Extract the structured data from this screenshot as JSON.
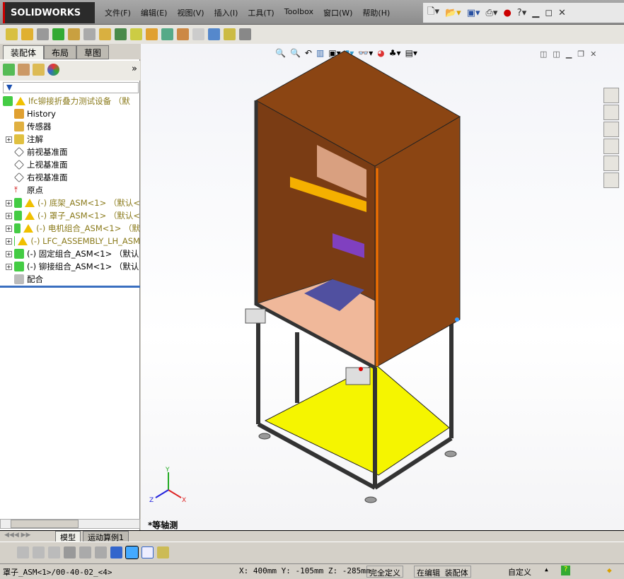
{
  "app": {
    "logo": "SOLIDWORKS"
  },
  "menu": [
    "文件(F)",
    "编辑(E)",
    "视图(V)",
    "插入(I)",
    "工具(T)",
    "Toolbox",
    "窗口(W)",
    "帮助(H)"
  ],
  "panel_tabs": [
    "装配体",
    "布局",
    "草图"
  ],
  "tree": {
    "root": "lfc铆接折叠力测试设备 （默",
    "items": [
      {
        "label": "History",
        "type": "history"
      },
      {
        "label": "传感器",
        "type": "sensor"
      },
      {
        "label": "注解",
        "type": "annotation",
        "expand": "+"
      },
      {
        "label": "前视基准面",
        "type": "plane"
      },
      {
        "label": "上视基准面",
        "type": "plane"
      },
      {
        "label": "右视基准面",
        "type": "plane"
      },
      {
        "label": "原点",
        "type": "origin"
      },
      {
        "label": "(-) 底架_ASM<1> （默认<",
        "type": "asm",
        "warn": true,
        "expand": "+"
      },
      {
        "label": "(-) 罩子_ASM<1> （默认<",
        "type": "asm",
        "warn": true,
        "expand": "+"
      },
      {
        "label": "(-) 电机组合_ASM<1> （默",
        "type": "asm",
        "warn": true,
        "expand": "+"
      },
      {
        "label": "(-) LFC_ASSEMBLY_LH_ASM",
        "type": "asm",
        "warn": true,
        "expand": "+"
      },
      {
        "label": "(-) 固定组合_ASM<1> （默认",
        "type": "asm",
        "warn": false,
        "expand": "+"
      },
      {
        "label": "(-) 铆接组合_ASM<1> （默认",
        "type": "asm",
        "warn": false,
        "expand": "+"
      },
      {
        "label": "配合",
        "type": "mate"
      }
    ]
  },
  "view": {
    "label": "*等轴测",
    "axes": {
      "x": "X",
      "y": "Y",
      "z": "Z"
    }
  },
  "bottom_tabs": [
    "模型",
    "运动算例1"
  ],
  "status": {
    "selection": "罩子_ASM<1>/00-40-02_<4>",
    "coords": "X: 400mm Y: -105mm Z: -285mm",
    "defined": "完全定义",
    "editing": "在编辑 装配体",
    "units": "自定义"
  },
  "colors": {
    "cabinet": "#8b4513",
    "platform": "#f5f500"
  }
}
